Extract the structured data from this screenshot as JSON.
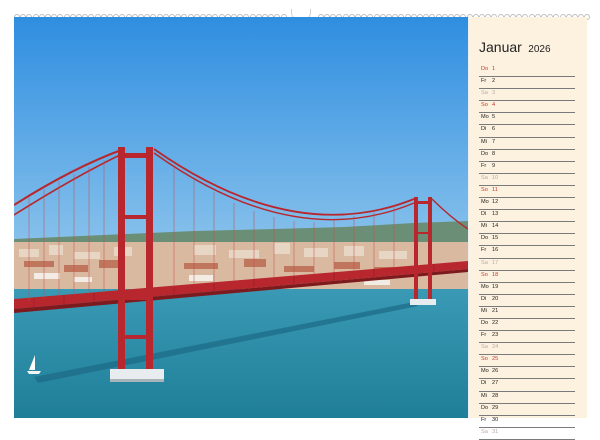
{
  "calendar": {
    "month": "Januar",
    "year": "2026",
    "days": [
      {
        "dn": "Do",
        "num": "1",
        "type": "sun"
      },
      {
        "dn": "Fr",
        "num": "2",
        "type": ""
      },
      {
        "dn": "Sa",
        "num": "3",
        "type": "we"
      },
      {
        "dn": "So",
        "num": "4",
        "type": "sun"
      },
      {
        "dn": "Mo",
        "num": "5",
        "type": ""
      },
      {
        "dn": "Di",
        "num": "6",
        "type": ""
      },
      {
        "dn": "Mi",
        "num": "7",
        "type": ""
      },
      {
        "dn": "Do",
        "num": "8",
        "type": ""
      },
      {
        "dn": "Fr",
        "num": "9",
        "type": ""
      },
      {
        "dn": "Sa",
        "num": "10",
        "type": "we"
      },
      {
        "dn": "So",
        "num": "11",
        "type": "sun"
      },
      {
        "dn": "Mo",
        "num": "12",
        "type": ""
      },
      {
        "dn": "Di",
        "num": "13",
        "type": ""
      },
      {
        "dn": "Mi",
        "num": "14",
        "type": ""
      },
      {
        "dn": "Do",
        "num": "15",
        "type": ""
      },
      {
        "dn": "Fr",
        "num": "16",
        "type": ""
      },
      {
        "dn": "Sa",
        "num": "17",
        "type": "we"
      },
      {
        "dn": "So",
        "num": "18",
        "type": "sun"
      },
      {
        "dn": "Mo",
        "num": "19",
        "type": ""
      },
      {
        "dn": "Di",
        "num": "20",
        "type": ""
      },
      {
        "dn": "Mi",
        "num": "21",
        "type": ""
      },
      {
        "dn": "Do",
        "num": "22",
        "type": ""
      },
      {
        "dn": "Fr",
        "num": "23",
        "type": ""
      },
      {
        "dn": "Sa",
        "num": "24",
        "type": "we"
      },
      {
        "dn": "So",
        "num": "25",
        "type": "sun"
      },
      {
        "dn": "Mo",
        "num": "26",
        "type": ""
      },
      {
        "dn": "Di",
        "num": "27",
        "type": ""
      },
      {
        "dn": "Mi",
        "num": "28",
        "type": ""
      },
      {
        "dn": "Do",
        "num": "29",
        "type": ""
      },
      {
        "dn": "Fr",
        "num": "30",
        "type": ""
      },
      {
        "dn": "Sa",
        "num": "31",
        "type": "we"
      }
    ]
  },
  "colors": {
    "panel_bg": "#fdf2e0",
    "sunday_red": "#c0392b",
    "saturday_grey": "#b9a9a4",
    "bridge_red": "#b8272d",
    "sky_blue": "#3f98da",
    "water_teal": "#2e8fa8"
  }
}
